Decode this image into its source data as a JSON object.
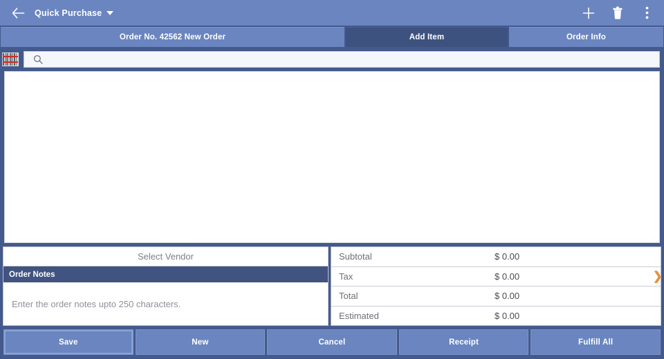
{
  "appbar": {
    "back_icon": "arrow-left-icon",
    "title": "Quick Purchase",
    "dropdown_icon": "caret-down-icon",
    "actions": [
      {
        "icon": "plus-icon",
        "label": "Add"
      },
      {
        "icon": "trash-icon",
        "label": "Delete"
      },
      {
        "icon": "overflow-menu-icon",
        "label": "More options"
      }
    ]
  },
  "tabs": [
    {
      "label": "Order No. 42562 New Order",
      "active": false
    },
    {
      "label": "Add Item",
      "active": true
    },
    {
      "label": "Order Info",
      "active": false
    }
  ],
  "search": {
    "barcode_icon": "barcode-scanner-icon",
    "magnifier_icon": "search-icon",
    "value": "",
    "placeholder": ""
  },
  "items": {
    "rows": []
  },
  "vendor": {
    "label": "Select Vendor"
  },
  "notes": {
    "header": "Order Notes",
    "value": "",
    "placeholder": "Enter the order notes upto 250 characters."
  },
  "totals": [
    {
      "label": "Subtotal",
      "value": "$ 0.00",
      "chevron": false
    },
    {
      "label": "Tax",
      "value": "$ 0.00",
      "chevron": true
    },
    {
      "label": "Total",
      "value": "$ 0.00",
      "chevron": false
    },
    {
      "label": "Estimated",
      "value": "$ 0.00",
      "chevron": false
    }
  ],
  "chevron_glyph": "❯",
  "actions": [
    {
      "label": "Save",
      "focused": true
    },
    {
      "label": "New",
      "focused": false
    },
    {
      "label": "Cancel",
      "focused": false
    },
    {
      "label": "Receipt",
      "focused": false
    },
    {
      "label": "Fulfill All",
      "focused": false
    }
  ],
  "colors": {
    "appbar_blue": "#6a85c0",
    "frame_navy": "#44598c",
    "active_tab_navy": "#3e5280",
    "notes_header_navy": "#415380",
    "chevron_orange": "#e8903a",
    "panel_white": "#ffffff"
  }
}
